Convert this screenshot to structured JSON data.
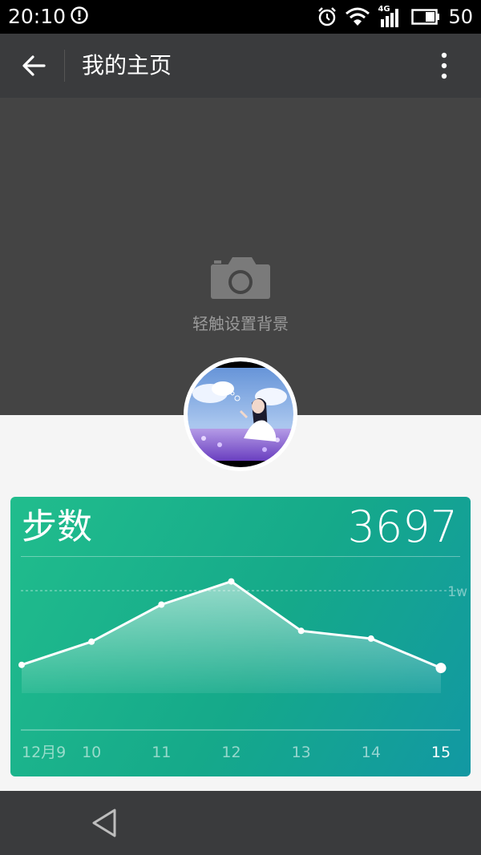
{
  "status_bar": {
    "time": "20:10",
    "network": "4G",
    "battery": "50"
  },
  "app_bar": {
    "title": "我的主页"
  },
  "cover": {
    "hint": "轻触设置背景"
  },
  "steps_card": {
    "label": "步数",
    "value": "3697"
  },
  "chart_data": {
    "type": "area",
    "categories": [
      "12月9",
      "10",
      "11",
      "12",
      "13",
      "14",
      "15"
    ],
    "values": [
      5200,
      6700,
      9100,
      10600,
      7400,
      6900,
      5000
    ],
    "reference_line": {
      "label": "1w",
      "value": 10000
    },
    "ylim": [
      0,
      14000
    ],
    "grid": false
  },
  "colors": {
    "card_start": "#21bd8d",
    "card_end": "#1298a3",
    "app_bar": "#3a3b3d",
    "cover": "#444444"
  }
}
